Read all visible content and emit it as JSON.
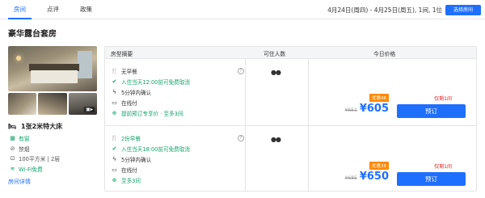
{
  "nav": {
    "tabs": [
      "房间",
      "点评",
      "政策"
    ],
    "active_tab": 0,
    "date_info": "4月24日(周四) - 4月25日(周五), 1间, 1位",
    "select_button": "选择房间"
  },
  "room": {
    "title": "豪华露台套房",
    "photo_count_icon": "image-icon",
    "bed_type": "1张2米特大床",
    "features": [
      "有窗",
      "禁烟",
      "100平方米 | 2层",
      "Wi-Fi免费"
    ],
    "details_link": "房间详情"
  },
  "table": {
    "headers": [
      "房型摘要",
      "可住人数",
      "今日价格"
    ],
    "rows": [
      {
        "policies": [
          "无早餐",
          "入住当天12:00前可免费取消",
          "5分钟内确认",
          "在线付",
          "提前预订专享价 · 至多3间"
        ],
        "occupancy": "adults-2-icon",
        "discount": "优惠46",
        "original_price": "¥651",
        "price": "¥605",
        "stock": "仅剩1间",
        "book_button": "预订"
      },
      {
        "policies": [
          "2份早餐",
          "入住当天18:00前可免费取消",
          "5分钟内确认",
          "在线付",
          "至多3间"
        ],
        "occupancy": "adults-2-icon",
        "discount": "优惠35",
        "original_price": "¥685",
        "price": "¥650",
        "stock": "仅剩1间",
        "book_button": "预订"
      }
    ]
  },
  "colors": {
    "accent": "#1f6fff",
    "green": "#11a36b",
    "discount": "#ff8a00",
    "stock": "#e02020"
  }
}
